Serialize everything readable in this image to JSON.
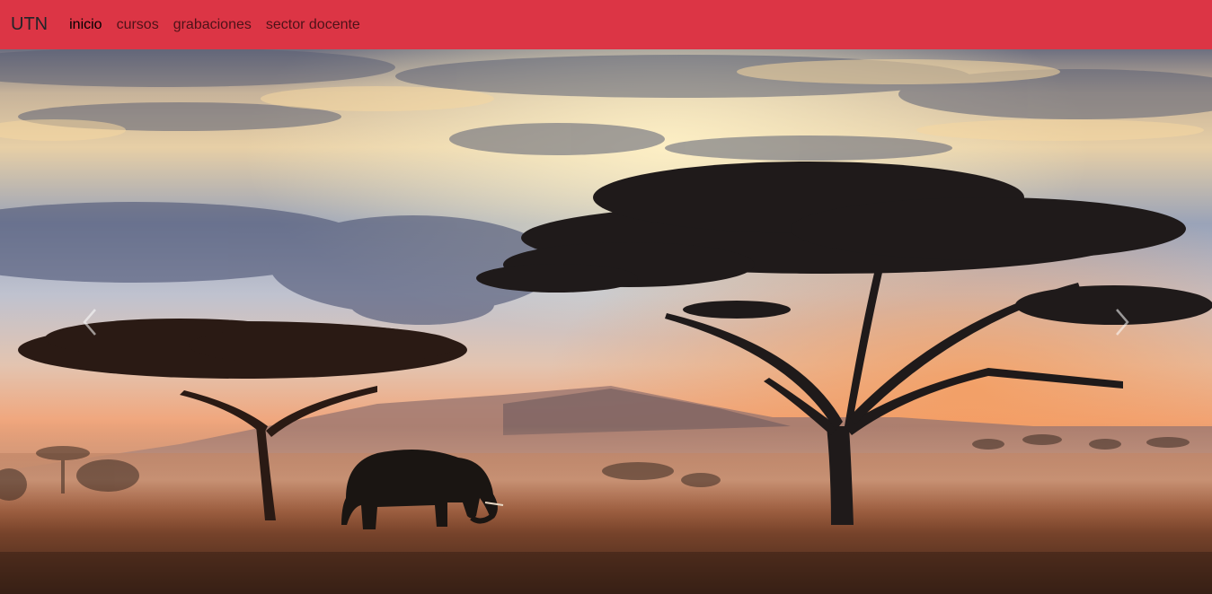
{
  "navbar": {
    "brand": "UTN",
    "links": [
      {
        "label": "inicio",
        "active": true
      },
      {
        "label": "cursos",
        "active": false
      },
      {
        "label": "grabaciones",
        "active": false
      },
      {
        "label": "sector docente",
        "active": false
      }
    ],
    "background_color": "#dc3545"
  },
  "carousel": {
    "prev_icon": "chevron-left-icon",
    "next_icon": "chevron-right-icon"
  }
}
